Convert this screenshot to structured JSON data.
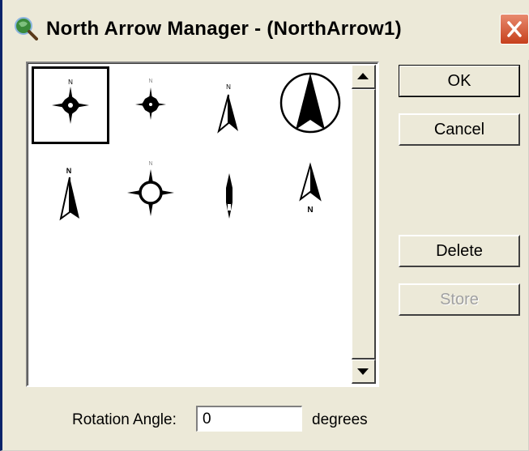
{
  "window": {
    "title": "North Arrow Manager - (NorthArrow1)",
    "close_icon": "close-icon",
    "app_icon": "globe-magnifier-icon"
  },
  "arrows": {
    "items": [
      {
        "style": "compass-star",
        "selected": true,
        "north_label": "N"
      },
      {
        "style": "compass-star-small",
        "selected": false,
        "north_label": "N"
      },
      {
        "style": "half-arrow",
        "selected": false,
        "north_label": "N"
      },
      {
        "style": "circle-arrow",
        "selected": false,
        "north_label": ""
      },
      {
        "style": "slim-half-arrow",
        "selected": false,
        "north_label": "N"
      },
      {
        "style": "ring-compass",
        "selected": false,
        "north_label": "N"
      },
      {
        "style": "needle",
        "selected": false,
        "north_label": ""
      },
      {
        "style": "outline-arrow",
        "selected": false,
        "north_label": "N"
      }
    ]
  },
  "scrollbar": {
    "up_icon": "scroll-up-arrow-icon",
    "down_icon": "scroll-down-arrow-icon"
  },
  "buttons": {
    "ok": "OK",
    "cancel": "Cancel",
    "delete": "Delete",
    "store": "Store"
  },
  "rotation": {
    "label": "Rotation Angle:",
    "value": "0",
    "unit": "degrees"
  },
  "colors": {
    "dialog_bg": "#ece9d8",
    "titlebar_border": "#0a246a",
    "close_button": "#c6401c",
    "disabled_text": "#a0a0a0"
  }
}
